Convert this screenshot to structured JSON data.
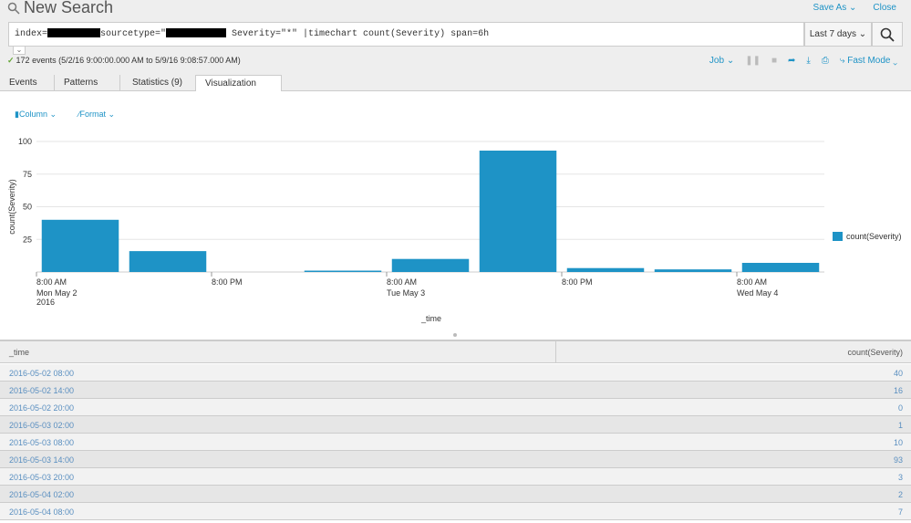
{
  "header": {
    "title": "New Search",
    "save_as": "Save As",
    "close": "Close"
  },
  "search": {
    "query_prefix": "index=",
    "query_sourcetype": "sourcetype=\"",
    "query_rest": " Severity=\"*\" |timechart count(Severity) span=6h",
    "time_range": "Last 7 days"
  },
  "status": {
    "text": "172 events (5/2/16 9:00:00.000 AM to 5/9/16 9:08:57.000 AM)"
  },
  "job_controls": {
    "job_label": "Job",
    "mode_label": "Fast Mode"
  },
  "tabs": [
    {
      "label": "Events"
    },
    {
      "label": "Patterns"
    },
    {
      "label": "Statistics (9)"
    },
    {
      "label": "Visualization"
    }
  ],
  "viz_menu": {
    "column_label": "Column",
    "format_label": "Format"
  },
  "colors": {
    "bar": "#1e93c6",
    "link": "#1e93c6"
  },
  "icons": [
    "search-icon",
    "chevron-down-icon",
    "pause-icon",
    "stop-icon",
    "share-icon",
    "export-icon",
    "print-icon",
    "lightning-icon",
    "bar-chart-icon",
    "brush-icon"
  ],
  "chart_data": {
    "type": "bar",
    "categories": [
      "2016-05-02 08:00",
      "2016-05-02 14:00",
      "2016-05-02 20:00",
      "2016-05-03 02:00",
      "2016-05-03 08:00",
      "2016-05-03 14:00",
      "2016-05-03 20:00",
      "2016-05-04 02:00",
      "2016-05-04 08:00"
    ],
    "series": [
      {
        "name": "count(Severity)",
        "values": [
          40,
          16,
          0,
          1,
          10,
          93,
          3,
          2,
          7
        ]
      }
    ],
    "xlabel": "_time",
    "ylabel": "count(Severity)",
    "ylim": [
      0,
      100
    ],
    "yticks": [
      "25",
      "50",
      "75",
      "100"
    ],
    "xtick_labels": [
      {
        "line1": "8:00 AM",
        "line2": "Mon May 2",
        "line3": "2016"
      },
      {
        "line1": "8:00 PM",
        "line2": "",
        "line3": ""
      },
      {
        "line1": "8:00 AM",
        "line2": "Tue May 3",
        "line3": ""
      },
      {
        "line1": "8:00 PM",
        "line2": "",
        "line3": ""
      },
      {
        "line1": "8:00 AM",
        "line2": "Wed May 4",
        "line3": ""
      }
    ],
    "legend_position": "right",
    "grid": true
  },
  "table": {
    "headers": [
      "_time",
      "count(Severity)"
    ],
    "rows": [
      [
        "2016-05-02 08:00",
        "40"
      ],
      [
        "2016-05-02 14:00",
        "16"
      ],
      [
        "2016-05-02 20:00",
        "0"
      ],
      [
        "2016-05-03 02:00",
        "1"
      ],
      [
        "2016-05-03 08:00",
        "10"
      ],
      [
        "2016-05-03 14:00",
        "93"
      ],
      [
        "2016-05-03 20:00",
        "3"
      ],
      [
        "2016-05-04 02:00",
        "2"
      ],
      [
        "2016-05-04 08:00",
        "7"
      ]
    ]
  }
}
